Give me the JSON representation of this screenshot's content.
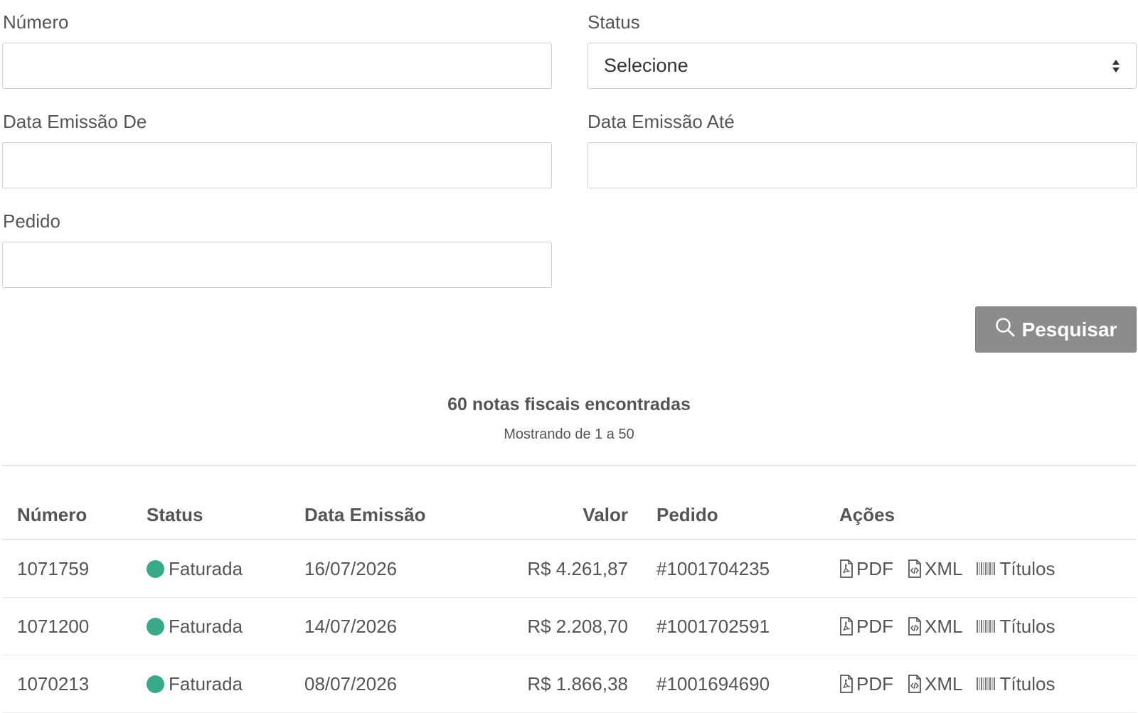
{
  "form": {
    "numero_label": "Número",
    "numero_value": "",
    "status_label": "Status",
    "status_selected": "Selecione",
    "data_de_label": "Data Emissão De",
    "data_de_value": "",
    "data_ate_label": "Data Emissão Até",
    "data_ate_value": "",
    "pedido_label": "Pedido",
    "pedido_value": "",
    "search_button_label": "Pesquisar"
  },
  "results": {
    "count_text": "60 notas fiscais encontradas",
    "range_text": "Mostrando de 1 a 50"
  },
  "table": {
    "headers": {
      "numero": "Número",
      "status": "Status",
      "data": "Data Emissão",
      "valor": "Valor",
      "pedido": "Pedido",
      "acoes": "Ações"
    },
    "rows": [
      {
        "numero": "1071759",
        "status": "Faturada",
        "data": "16/07/2026",
        "valor": "R$ 4.261,87",
        "pedido": "#1001704235"
      },
      {
        "numero": "1071200",
        "status": "Faturada",
        "data": "14/07/2026",
        "valor": "R$ 2.208,70",
        "pedido": "#1001702591"
      },
      {
        "numero": "1070213",
        "status": "Faturada",
        "data": "08/07/2026",
        "valor": "R$ 1.866,38",
        "pedido": "#1001694690"
      }
    ],
    "actions": {
      "pdf": "PDF",
      "xml": "XML",
      "titulos": "Títulos"
    }
  },
  "colors": {
    "status_faturada": "#3aa98a",
    "button_bg": "#8c8c8c"
  },
  "icons": {
    "search": "search-icon",
    "pdf": "pdf-file-icon",
    "xml": "code-file-icon",
    "titulos": "barcode-icon",
    "select": "sort-arrows-icon"
  }
}
